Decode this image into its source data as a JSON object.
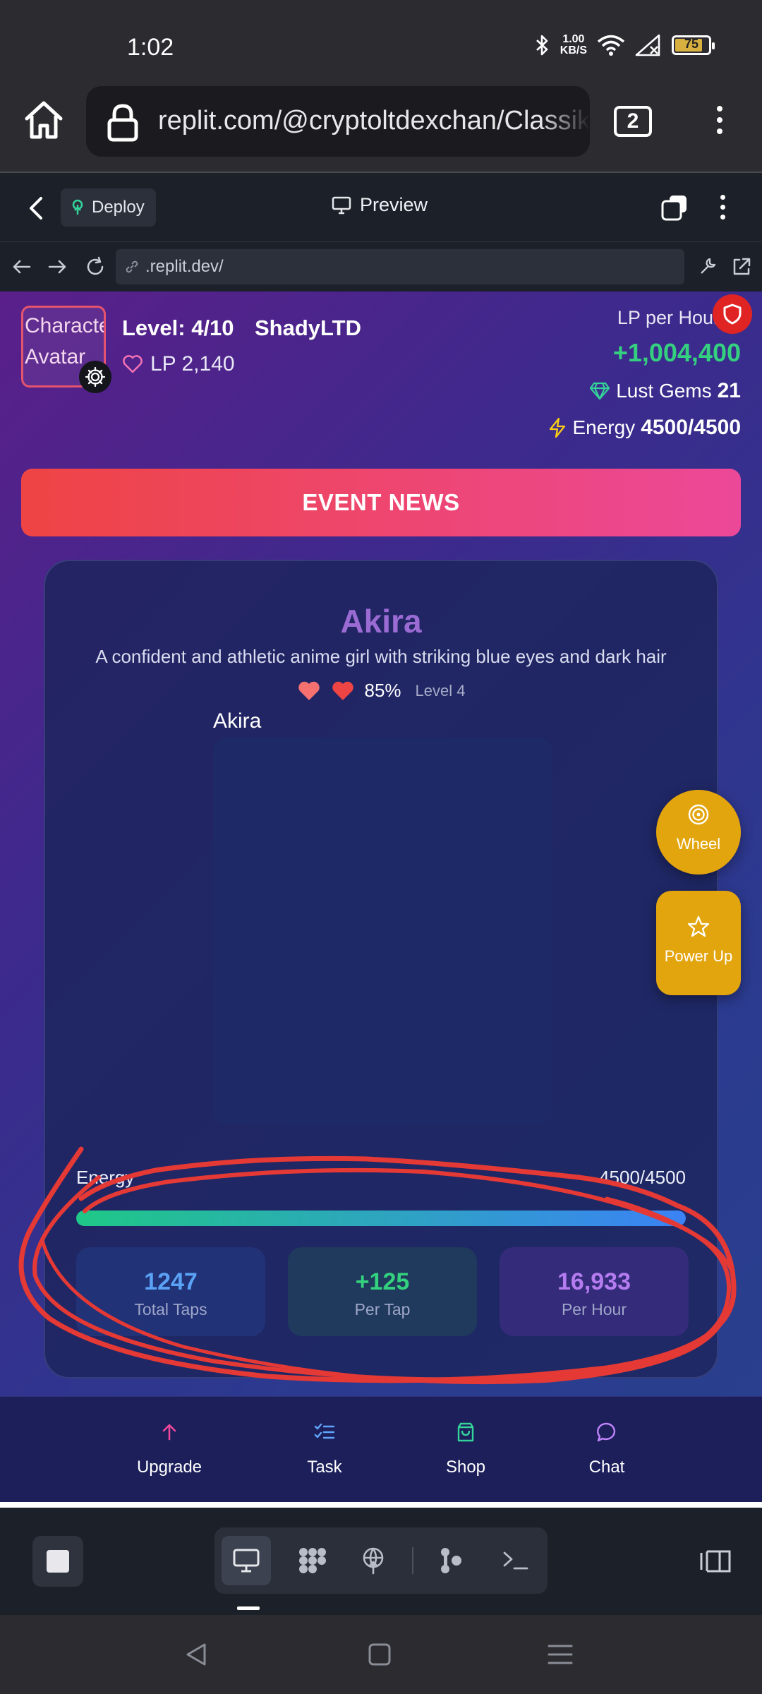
{
  "status_bar": {
    "time": "1:02",
    "net_speed_value": "1.00",
    "net_speed_unit": "KB/S",
    "battery_level": "75"
  },
  "browser": {
    "url": "replit.com/@cryptoltdexchan/ClassikLust",
    "tab_count": "2"
  },
  "replit": {
    "deploy_label": "Deploy",
    "preview_label": "Preview",
    "address": ".replit.dev/"
  },
  "game": {
    "avatar_text": "Character Avatar",
    "level": "Level: 4/10",
    "username": "ShadyLTD",
    "lp": "LP 2,140",
    "lp_per_hour_label": "LP per Hour",
    "lp_per_hour_value": "+1,004,400",
    "gems_label": "Lust Gems",
    "gems_value": "21",
    "energy_label": "Energy",
    "energy_value": "4500/4500",
    "event_button": "EVENT NEWS",
    "character": {
      "name": "Akira",
      "description": "A confident and athletic anime girl with striking blue eyes and dark hair",
      "affection": "85%",
      "level_tag": "Level 4",
      "image_alt": "Akira"
    },
    "energy_bar": {
      "label": "Energy",
      "value": "4500/4500",
      "fill_fraction": 1.0
    },
    "stats": [
      {
        "value": "1247",
        "label": "Total Taps"
      },
      {
        "value": "+125",
        "label": "Per Tap"
      },
      {
        "value": "16,933",
        "label": "Per Hour"
      }
    ],
    "fab": {
      "wheel": "Wheel",
      "power_up": "Power Up"
    },
    "nav": [
      {
        "label": "Upgrade",
        "icon": "arrow-up-icon",
        "color": "#ec4899"
      },
      {
        "label": "Task",
        "icon": "checklist-icon",
        "color": "#60a5fa"
      },
      {
        "label": "Shop",
        "icon": "shopping-bag-icon",
        "color": "#34d399"
      },
      {
        "label": "Chat",
        "icon": "chat-bubble-icon",
        "color": "#c084fc"
      }
    ]
  },
  "colors": {
    "accent_green": "#35d07f",
    "event_gradient_start": "#ef4444",
    "event_gradient_end": "#ec4899",
    "fab_gold": "#e3a50d",
    "annotation_red": "#e53935"
  }
}
